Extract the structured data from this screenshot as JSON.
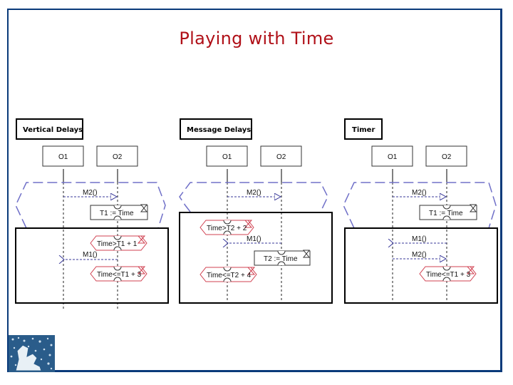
{
  "slide": {
    "title": "Playing with Time",
    "colors": {
      "frame": "#0a3a7a",
      "title": "#b01018",
      "guard": "#d04050",
      "message": "#3a3a9a",
      "region": "#7070c8"
    }
  },
  "diagrams": [
    {
      "header": "Vertical Delays",
      "objects": [
        "O1",
        "O2"
      ],
      "messages": [
        {
          "label": "M2()",
          "direction": "right"
        },
        {
          "label": "M1()",
          "direction": "left"
        }
      ],
      "actions": [
        {
          "label": "T1 := Time"
        }
      ],
      "guards": [
        {
          "label": "Time>T1 + 1"
        },
        {
          "label": "Time<=T1 + 3"
        }
      ]
    },
    {
      "header": "Message Delays",
      "objects": [
        "O1",
        "O2"
      ],
      "messages": [
        {
          "label": "M2()",
          "direction": "right"
        },
        {
          "label": "M1()",
          "direction": "left"
        }
      ],
      "actions": [
        {
          "label": "T2 := Time"
        }
      ],
      "guards": [
        {
          "label": "Time>T2 + 2"
        },
        {
          "label": "Time<=T2 + 4"
        }
      ]
    },
    {
      "header": "Timer",
      "objects": [
        "O1",
        "O2"
      ],
      "messages": [
        {
          "label": "M2()",
          "direction": "right"
        },
        {
          "label": "M1()",
          "direction": "left"
        },
        {
          "label": "M2()",
          "direction": "right"
        }
      ],
      "actions": [
        {
          "label": "T1 := Time"
        }
      ],
      "guards": [
        {
          "label": "Time<=T1 + 3"
        }
      ]
    }
  ]
}
